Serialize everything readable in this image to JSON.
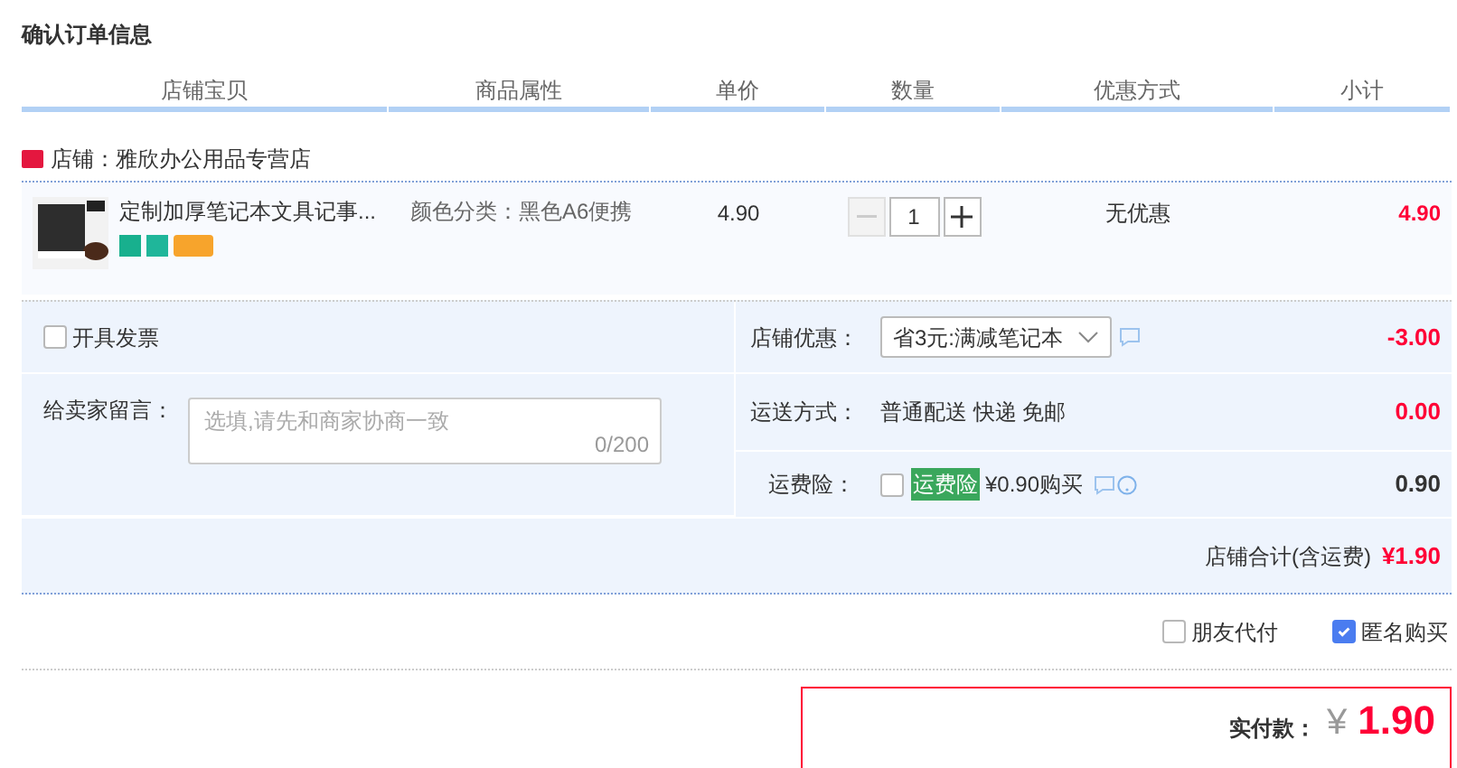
{
  "title": "确认订单信息",
  "columns": [
    "店铺宝贝",
    "商品属性",
    "单价",
    "数量",
    "优惠方式",
    "小计"
  ],
  "store": {
    "name": "店铺：雅欣办公用品专营店"
  },
  "item": {
    "name": "定制加厚笔记本文具记事...",
    "attribute": "颜色分类：黑色A6便携",
    "price": "4.90",
    "quantity": "1",
    "minus_disabled": true,
    "discount": "无优惠",
    "subtotal": "4.90"
  },
  "invoice": {
    "label": "开具发票",
    "checked": false
  },
  "message": {
    "label": "给卖家留言：",
    "placeholder": "选填,请先和商家协商一致",
    "counter": "0/200"
  },
  "store_discount": {
    "label": "店铺优惠：",
    "value": "省3元:满减笔记本",
    "amount": "-3.00"
  },
  "shipping": {
    "label": "运送方式：",
    "value": "普通配送 快递 免邮",
    "amount": "0.00"
  },
  "insurance": {
    "label": "运费险：",
    "checked": false,
    "badge": "运费险",
    "price": "¥0.90购买",
    "amount": "0.90"
  },
  "store_total": {
    "label": "店铺合计(含运费)",
    "amount": "¥1.90"
  },
  "options": [
    {
      "label": "朋友代付",
      "checked": false
    },
    {
      "label": "匿名购买",
      "checked": true
    }
  ],
  "payment": {
    "label": "实付款：",
    "currency": "¥",
    "amount": "1.90"
  }
}
